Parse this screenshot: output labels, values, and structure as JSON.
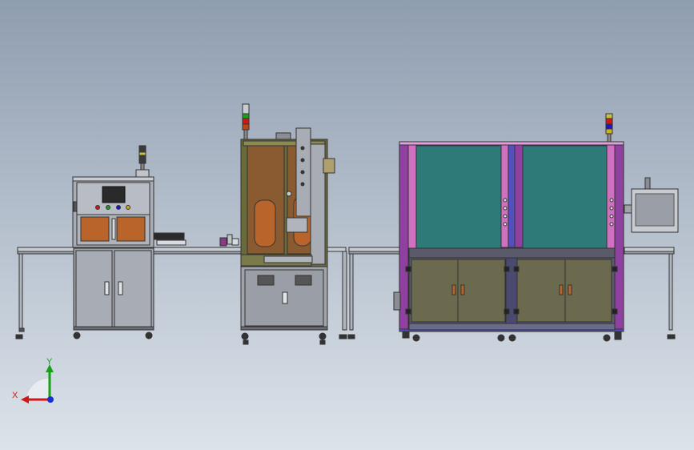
{
  "scene": {
    "background_top": "#8f9db0",
    "background_bottom": "#dce3ea",
    "icon_names": [
      "signal-tower-icon",
      "hmi-screen-icon",
      "cabinet-door-handle-icon",
      "caster-wheel-icon"
    ],
    "colors": {
      "frame_purple": "#9040a0",
      "frame_pink": "#d070c0",
      "frame_blue": "#5050c0",
      "glass_teal": "#2e7a78",
      "cabinet_olive": "#6b6a4e",
      "machine_grey": "#9a9ea6",
      "olive_panel": "#6a6a3a",
      "brown_window": "#8a5a30",
      "orange_window": "#b8642a"
    }
  },
  "triad": {
    "x_label": "X",
    "y_label": "Y",
    "x_color": "#d01818",
    "y_color": "#18a018",
    "z_color": "#1830d0"
  }
}
